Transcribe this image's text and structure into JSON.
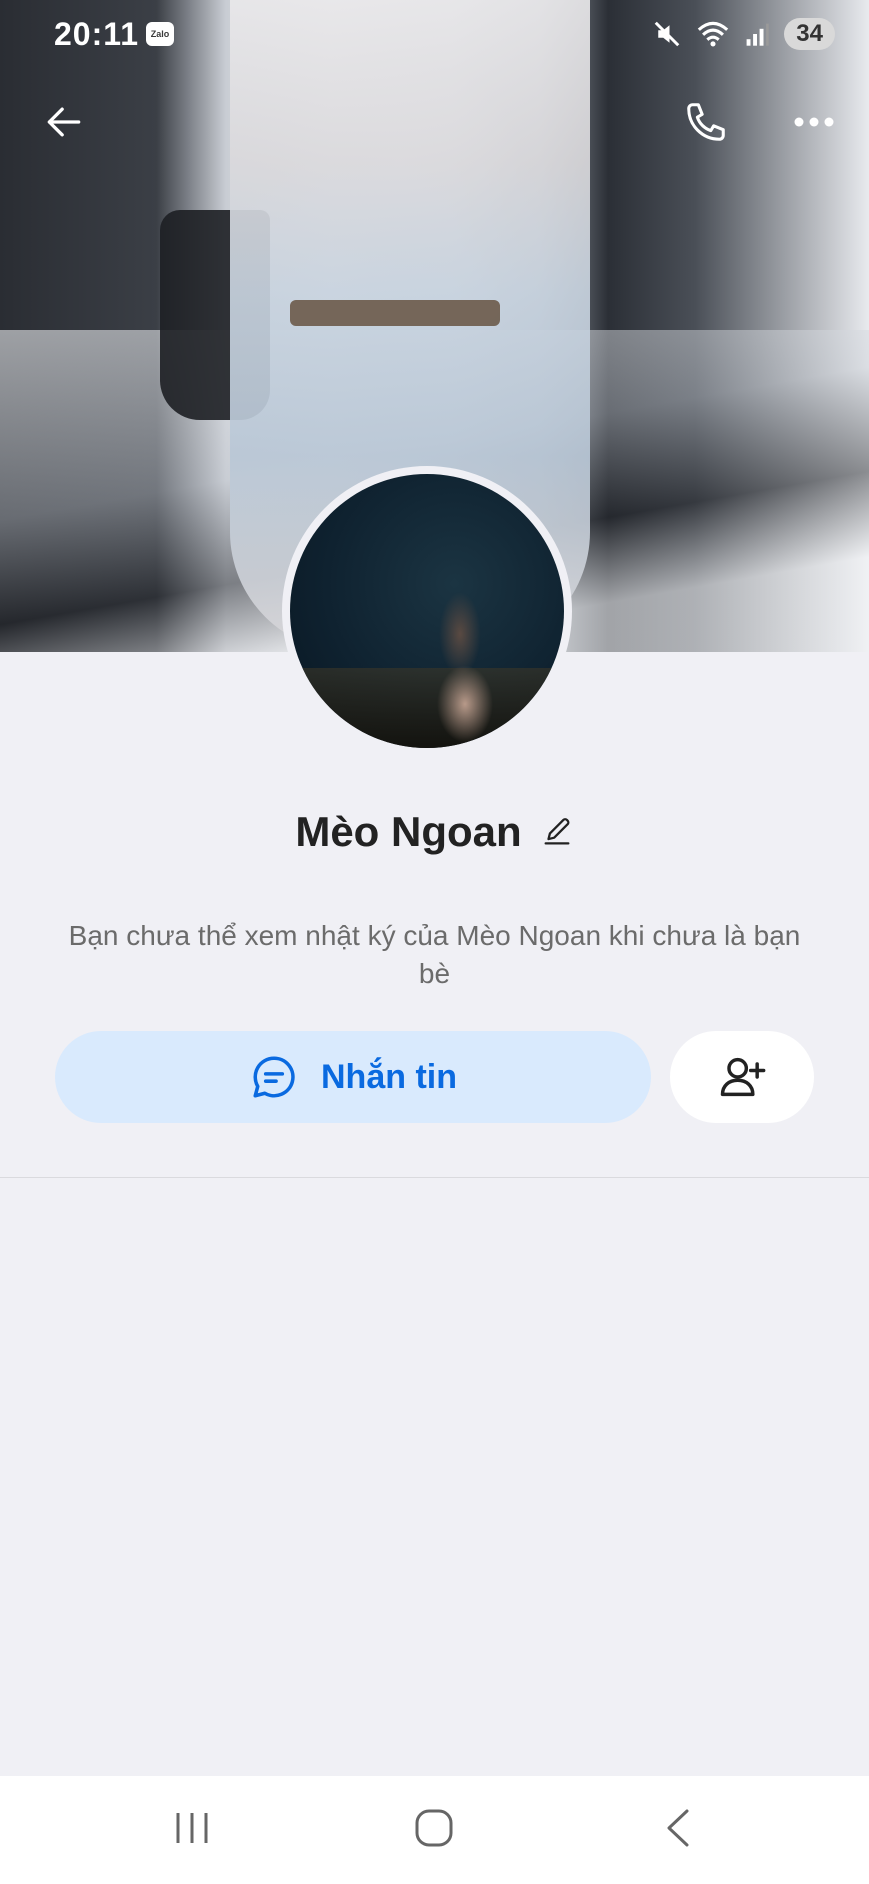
{
  "status_bar": {
    "time": "20:11",
    "notification_app": "Zalo",
    "battery": "34",
    "icons": [
      "mute-icon",
      "wifi-icon",
      "signal-icon"
    ]
  },
  "header": {
    "back_icon": "arrow-left-icon",
    "call_icon": "phone-icon",
    "more_icon": "more-horizontal-icon"
  },
  "profile": {
    "name": "Mèo Ngoan",
    "notice": "Bạn chưa thể xem nhật ký của Mèo Ngoan khi chưa là bạn bè"
  },
  "actions": {
    "message_label": "Nhắn tin",
    "message_icon": "chat-bubble-icon",
    "add_friend_icon": "add-user-icon"
  },
  "colors": {
    "accent": "#0a6ae0",
    "message_button_bg": "#d9eafd",
    "page_bg": "#f0f0f5"
  },
  "system_nav": [
    "recent-apps-icon",
    "home-icon",
    "back-chevron-icon"
  ]
}
